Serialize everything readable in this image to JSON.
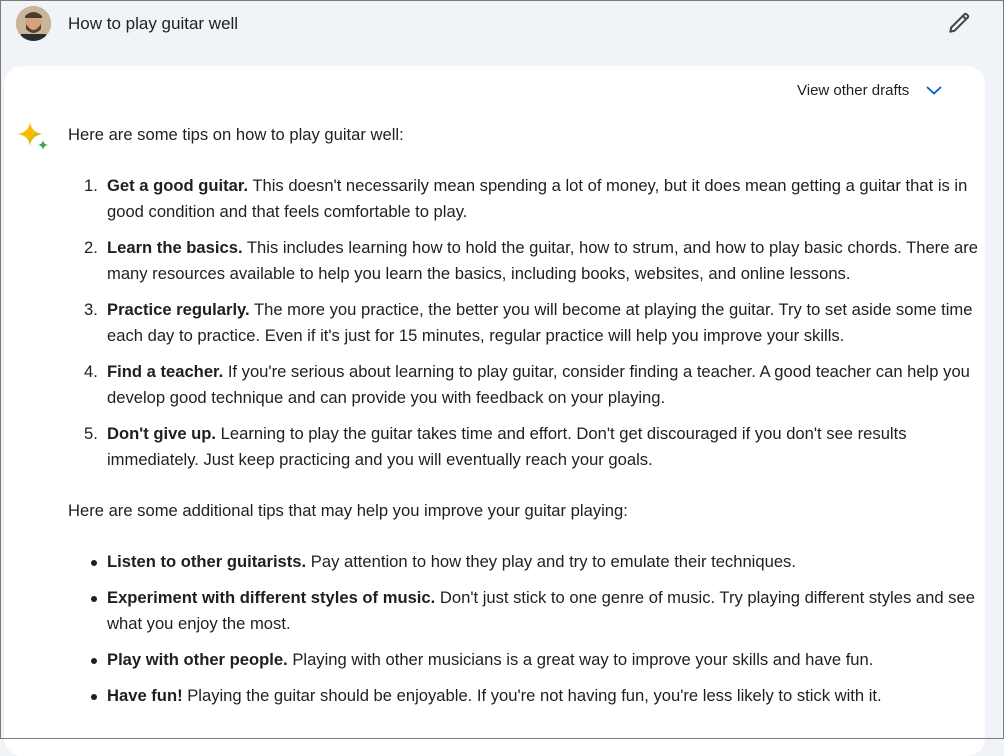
{
  "user_prompt": "How to play guitar well",
  "drafts_label": "View other drafts",
  "intro": "Here are some tips on how to play guitar well:",
  "tips": [
    {
      "num": "1.",
      "title": "Get a good guitar.",
      "text": " This doesn't necessarily mean spending a lot of money, but it does mean getting a guitar that is in good condition and that feels comfortable to play."
    },
    {
      "num": "2.",
      "title": "Learn the basics.",
      "text": " This includes learning how to hold the guitar, how to strum, and how to play basic chords. There are many resources available to help you learn the basics, including books, websites, and online lessons."
    },
    {
      "num": "3.",
      "title": "Practice regularly.",
      "text": " The more you practice, the better you will become at playing the guitar. Try to set aside some time each day to practice. Even if it's just for 15 minutes, regular practice will help you improve your skills."
    },
    {
      "num": "4.",
      "title": "Find a teacher.",
      "text": " If you're serious about learning to play guitar, consider finding a teacher. A good teacher can help you develop good technique and can provide you with feedback on your playing."
    },
    {
      "num": "5.",
      "title": "Don't give up.",
      "text": " Learning to play the guitar takes time and effort. Don't get discouraged if you don't see results immediately. Just keep practicing and you will eventually reach your goals."
    }
  ],
  "additional_intro": "Here are some additional tips that may help you improve your guitar playing:",
  "additional": [
    {
      "title": "Listen to other guitarists.",
      "text": " Pay attention to how they play and try to emulate their techniques."
    },
    {
      "title": "Experiment with different styles of music.",
      "text": " Don't just stick to one genre of music. Try playing different styles and see what you enjoy the most."
    },
    {
      "title": "Play with other people.",
      "text": " Playing with other musicians is a great way to improve your skills and have fun."
    },
    {
      "title": "Have fun!",
      "text": " Playing the guitar should be enjoyable. If you're not having fun, you're less likely to stick with it."
    }
  ],
  "icons": {
    "avatar": "user-avatar",
    "edit": "pencil-icon",
    "chevron": "chevron-down-icon",
    "sparkle": "gemini-sparkle-icon"
  },
  "colors": {
    "page_bg": "#f0f4f9",
    "card_bg": "#ffffff",
    "accent": "#0b57d0",
    "text": "#1f1f1f"
  }
}
